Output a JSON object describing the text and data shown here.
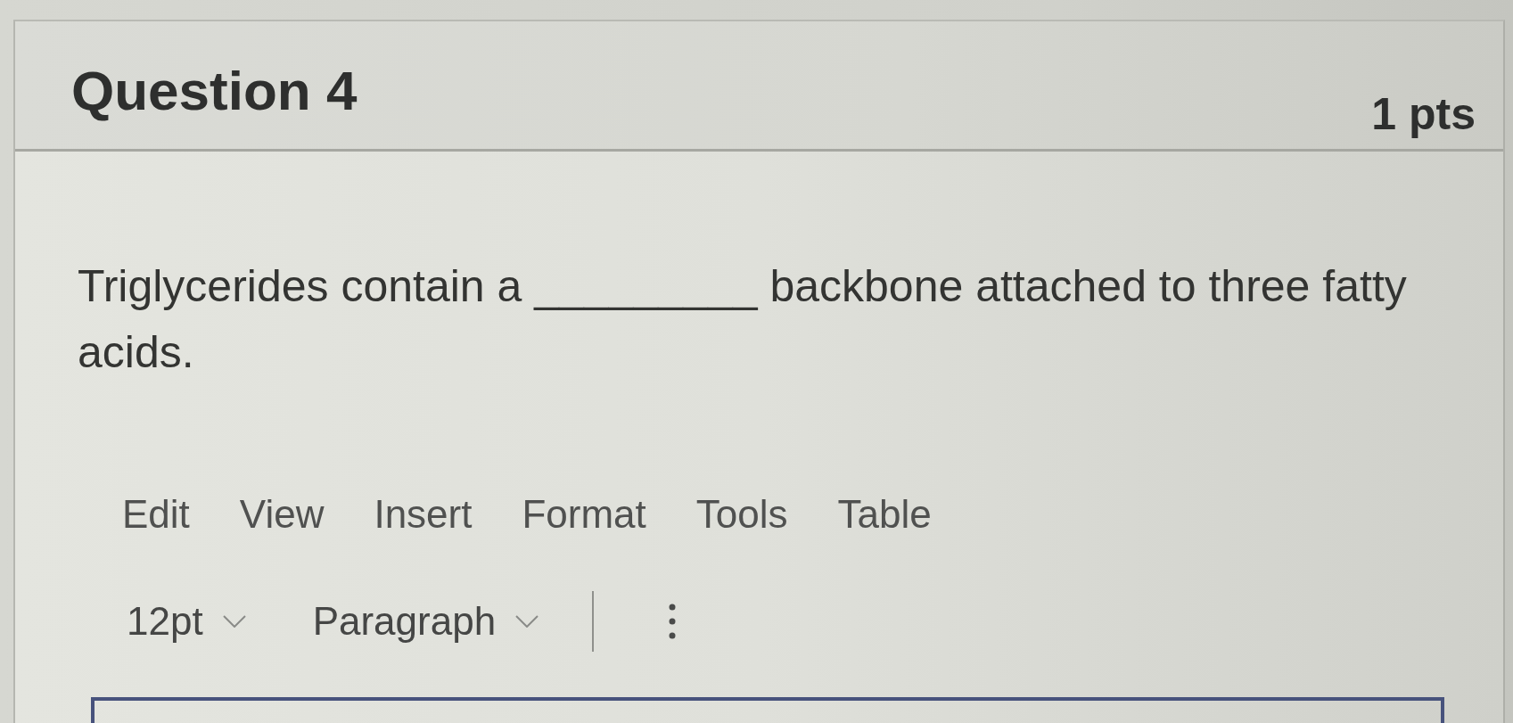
{
  "question": {
    "title": "Question 4",
    "points": "1 pts",
    "text": "Triglycerides contain a _________ backbone attached to three fatty acids."
  },
  "editor": {
    "menu": [
      "Edit",
      "View",
      "Insert",
      "Format",
      "Tools",
      "Table"
    ],
    "toolbar": [
      {
        "kind": "dropdown",
        "label": "12pt"
      },
      {
        "kind": "dropdown",
        "label": "Paragraph"
      },
      {
        "kind": "divider"
      },
      {
        "kind": "more"
      }
    ]
  }
}
